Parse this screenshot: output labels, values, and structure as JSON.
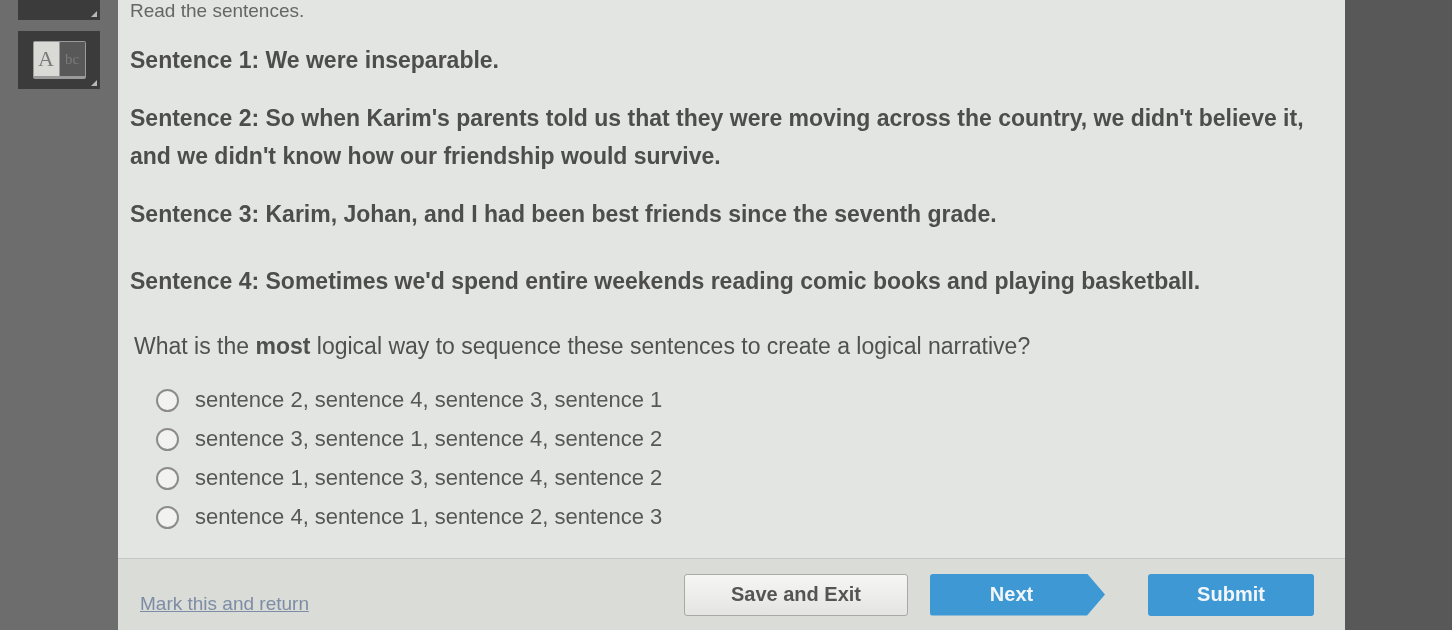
{
  "sidebar": {
    "tools": [
      {
        "kind": "cut"
      },
      {
        "kind": "dictionary",
        "page_letters": [
          "A",
          "bc"
        ]
      }
    ]
  },
  "prompt": "Read the sentences.",
  "sentences": [
    "Sentence 1: We were inseparable.",
    "Sentence 2: So when Karim's parents told us that they were moving across the country, we didn't believe it, and we didn't know how our friendship would survive.",
    "Sentence 3: Karim, Johan, and I had been best friends since the seventh grade.",
    "Sentence 4: Sometimes we'd spend entire weekends reading comic books and playing basketball."
  ],
  "question": "What is the **most** logical way to sequence these sentences to create a logical narrative?",
  "options": [
    {
      "text": "sentence 2, sentence 4, sentence 3, sentence 1",
      "selected": false
    },
    {
      "text": "sentence 3, sentence 1, sentence 4, sentence 2",
      "selected": false
    },
    {
      "text": "sentence 1, sentence 3, sentence 4, sentence 2",
      "selected": false
    },
    {
      "text": "sentence 4, sentence 1, sentence 2, sentence 3",
      "selected": false
    }
  ],
  "footer": {
    "mark_link": "Mark this and return",
    "buttons": [
      {
        "label": "Save and Exit",
        "kind": "secondary"
      },
      {
        "label": "Next",
        "kind": "next"
      },
      {
        "label": "Submit",
        "kind": "primary"
      }
    ]
  }
}
